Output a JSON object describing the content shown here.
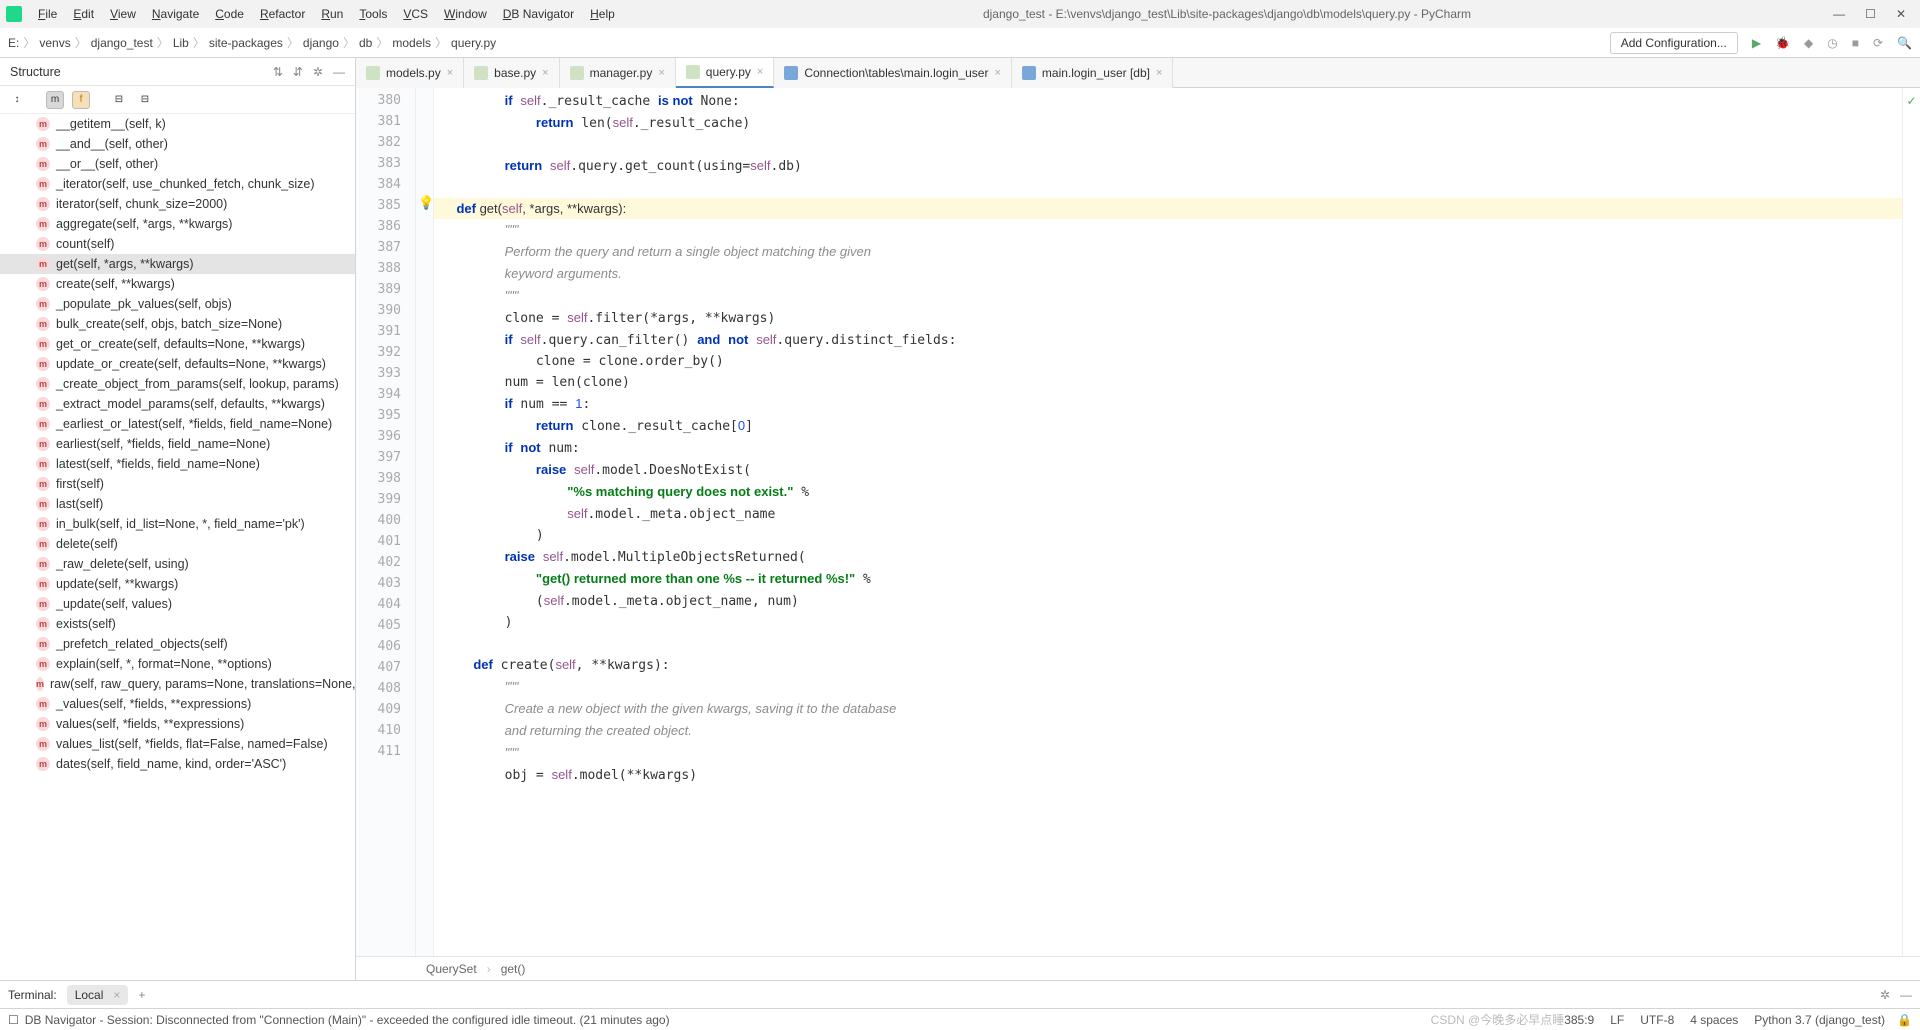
{
  "window_title": "django_test - E:\\venvs\\django_test\\Lib\\site-packages\\django\\db\\models\\query.py - PyCharm",
  "menu": [
    "File",
    "Edit",
    "View",
    "Navigate",
    "Code",
    "Refactor",
    "Run",
    "Tools",
    "VCS",
    "Window",
    "DB Navigator",
    "Help"
  ],
  "breadcrumbs": [
    "E:",
    "venvs",
    "django_test",
    "Lib",
    "site-packages",
    "django",
    "db",
    "models",
    "query.py"
  ],
  "add_config": "Add Configuration...",
  "structure_title": "Structure",
  "structure_items": [
    "__getitem__(self, k)",
    "__and__(self, other)",
    "__or__(self, other)",
    "_iterator(self, use_chunked_fetch, chunk_size)",
    "iterator(self, chunk_size=2000)",
    "aggregate(self, *args, **kwargs)",
    "count(self)",
    "get(self, *args, **kwargs)",
    "create(self, **kwargs)",
    "_populate_pk_values(self, objs)",
    "bulk_create(self, objs, batch_size=None)",
    "get_or_create(self, defaults=None, **kwargs)",
    "update_or_create(self, defaults=None, **kwargs)",
    "_create_object_from_params(self, lookup, params)",
    "_extract_model_params(self, defaults, **kwargs)",
    "_earliest_or_latest(self, *fields, field_name=None)",
    "earliest(self, *fields, field_name=None)",
    "latest(self, *fields, field_name=None)",
    "first(self)",
    "last(self)",
    "in_bulk(self, id_list=None, *, field_name='pk')",
    "delete(self)",
    "_raw_delete(self, using)",
    "update(self, **kwargs)",
    "_update(self, values)",
    "exists(self)",
    "_prefetch_related_objects(self)",
    "explain(self, *, format=None, **options)",
    "raw(self, raw_query, params=None, translations=None, u",
    "_values(self, *fields, **expressions)",
    "values(self, *fields, **expressions)",
    "values_list(self, *fields, flat=False, named=False)",
    "dates(self, field_name, kind, order='ASC')"
  ],
  "structure_selected": 7,
  "editor_tabs": [
    {
      "label": "models.py",
      "icon": "py"
    },
    {
      "label": "base.py",
      "icon": "py"
    },
    {
      "label": "manager.py",
      "icon": "py"
    },
    {
      "label": "query.py",
      "icon": "py",
      "active": true
    },
    {
      "label": "Connection\\tables\\main.login_user",
      "icon": "db"
    },
    {
      "label": "main.login_user [db]",
      "icon": "db"
    }
  ],
  "line_start": 380,
  "line_end": 411,
  "code_crumb": [
    "QuerySet",
    "get()"
  ],
  "terminal_label": "Terminal:",
  "terminal_tab": "Local",
  "status_msg": "DB Navigator - Session: Disconnected from \"Connection (Main)\" - exceeded the configured idle timeout. (21 minutes ago)",
  "status_right": [
    "385:9",
    "LF",
    "UTF-8",
    "4 spaces",
    "Python 3.7 (django_test)"
  ],
  "watermark": "CSDN @今晚多必早点睡"
}
